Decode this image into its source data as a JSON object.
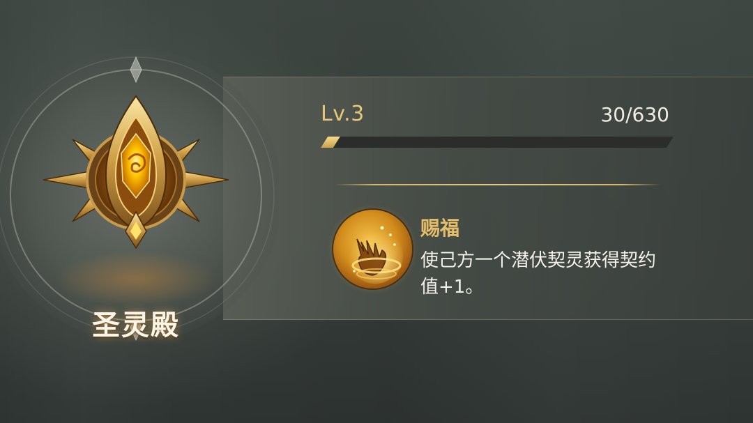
{
  "building": {
    "name": "圣灵殿",
    "emblem_icon": "golden-shield-crest-icon"
  },
  "level": {
    "label": "Lv.3",
    "xp_text": "30/630",
    "xp_current": 30,
    "xp_max": 630
  },
  "skill": {
    "icon": "blessing-hand-icon",
    "name": "赐福",
    "description": "使己方一个潜伏契灵获得契约值+1。"
  },
  "colors": {
    "accent_gold": "#e7c77a",
    "title_gold": "#e4be6a",
    "text_light": "#f3f1ea",
    "bar_track": "#2a2d2a"
  }
}
